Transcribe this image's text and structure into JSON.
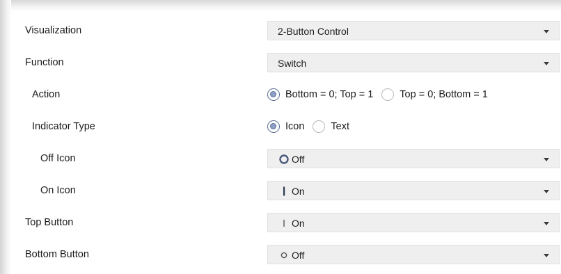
{
  "rows": {
    "visualization": {
      "label": "Visualization",
      "value": "2-Button Control"
    },
    "function": {
      "label": "Function",
      "value": "Switch"
    },
    "action": {
      "label": "Action",
      "options": [
        "Bottom = 0; Top = 1",
        "Top = 0; Bottom = 1"
      ],
      "selected": "Bottom = 0; Top = 1"
    },
    "indicator_type": {
      "label": "Indicator Type",
      "options": [
        "Icon",
        "Text"
      ],
      "selected": "Icon"
    },
    "off_icon": {
      "label": "Off Icon",
      "value": "Off",
      "icon": "ring-icon"
    },
    "on_icon": {
      "label": "On Icon",
      "value": "On",
      "icon": "bar-icon"
    },
    "top_button": {
      "label": "Top Button",
      "value": "On",
      "icon": "thin-bar-icon"
    },
    "bottom_button": {
      "label": "Bottom Button",
      "value": "Off",
      "icon": "small-ring-icon"
    }
  },
  "colors": {
    "select_bg": "#efefef",
    "radio_accent": "#5b6f9a",
    "text": "#1a1a1a"
  }
}
